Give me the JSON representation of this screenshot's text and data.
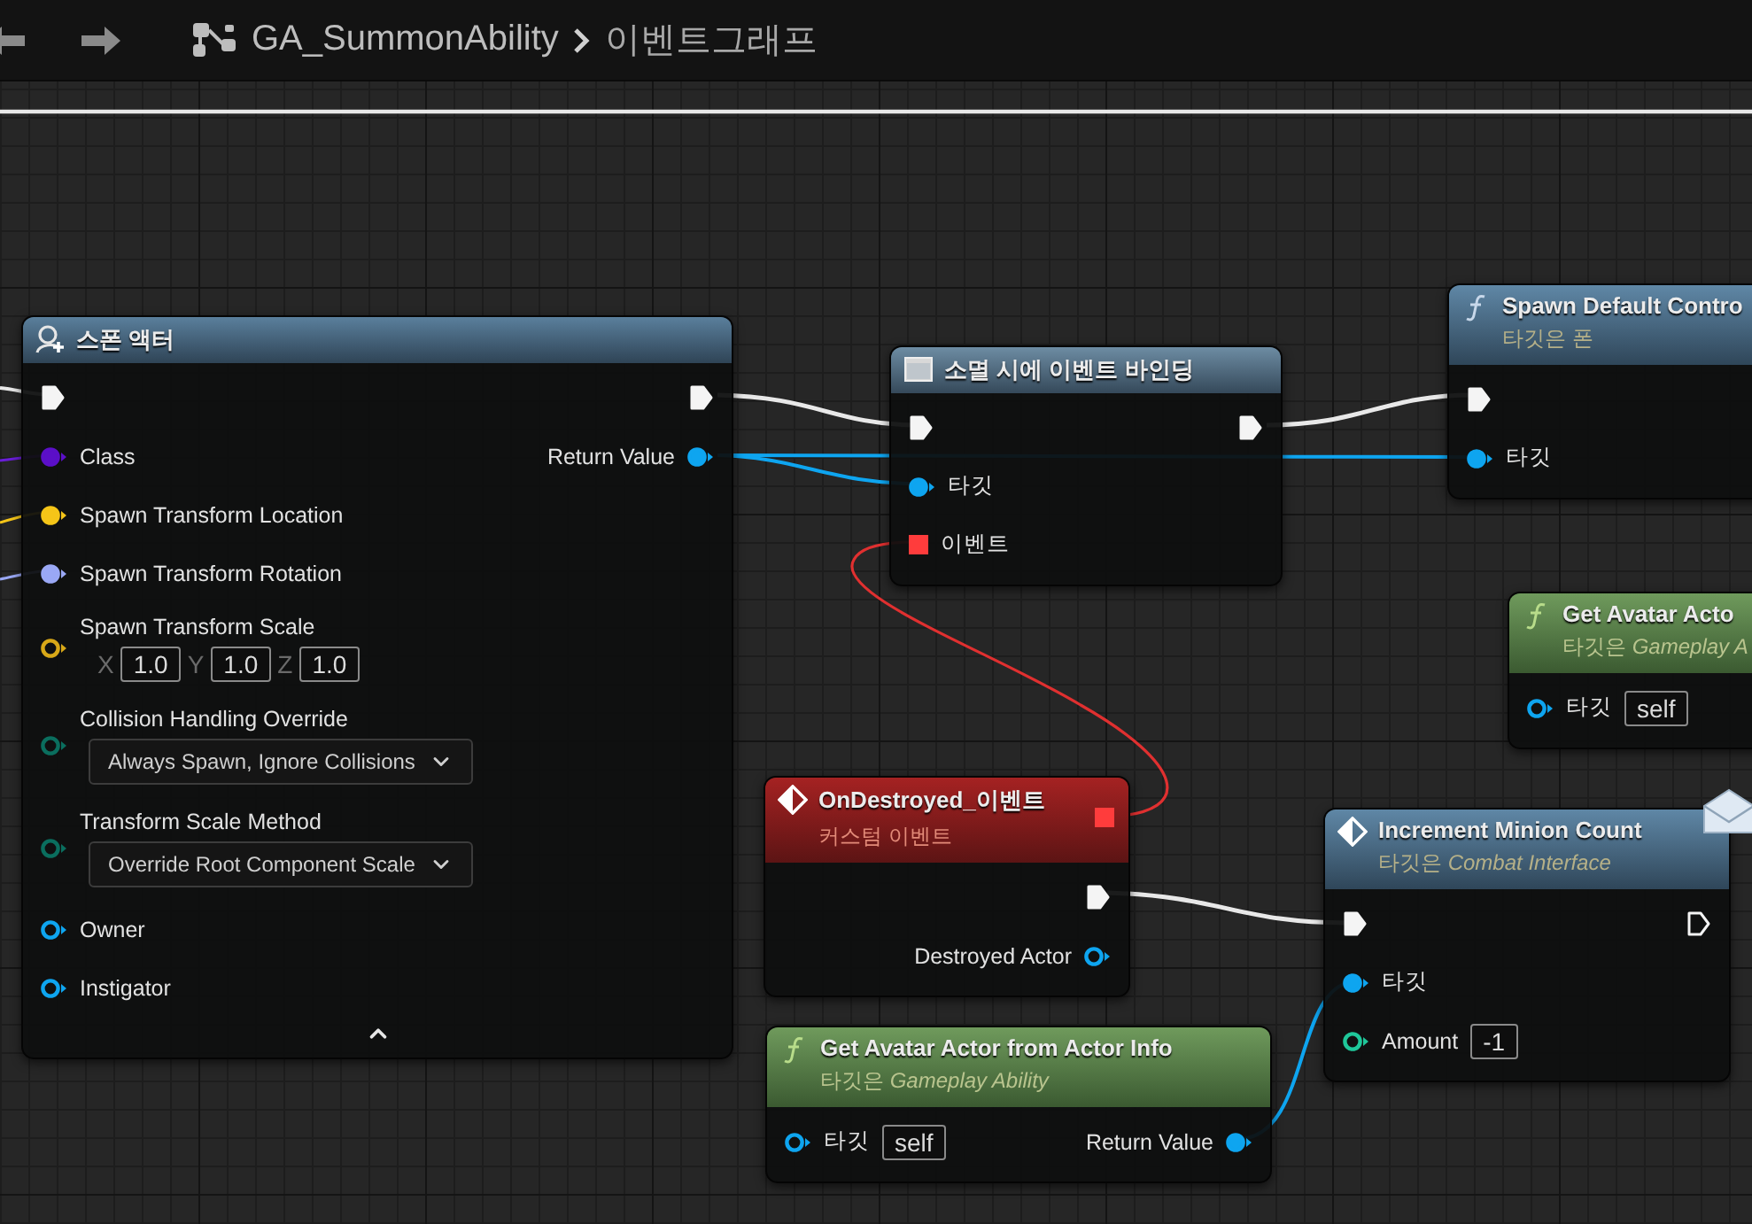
{
  "breadcrumb": {
    "asset": "GA_SummonAbility",
    "graph": "이벤트그래프"
  },
  "nodes": [
    {
      "kind": "spawn",
      "title": "스폰 액터",
      "advanced_expanded": true,
      "rows": [
        {
          "left": {
            "kind": "exec",
            "connected": true
          },
          "right": {
            "kind": "exec",
            "connected": true
          }
        },
        {
          "left": {
            "kind": "data",
            "connected": true,
            "color": "#5b0fc8",
            "label": "Class"
          },
          "right": {
            "kind": "data",
            "connected": true,
            "color": "#0ea5f0",
            "label": "Return Value"
          }
        },
        {
          "left": {
            "kind": "data",
            "connected": true,
            "color": "#f5c518",
            "label": "Spawn Transform Location"
          }
        },
        {
          "left": {
            "kind": "data",
            "connected": true,
            "color": "#9aa8f5",
            "label": "Spawn Transform Rotation"
          }
        },
        {
          "left": {
            "kind": "data",
            "connected": false,
            "color": "#d8a818",
            "label": "Spawn Transform Scale",
            "vector": [
              {
                "axis": "X",
                "value": "1.0"
              },
              {
                "axis": "Y",
                "value": "1.0"
              },
              {
                "axis": "Z",
                "value": "1.0"
              }
            ]
          }
        },
        {
          "left": {
            "kind": "data",
            "connected": false,
            "color": "#0a6e5e",
            "label": "Collision Handling Override",
            "dropdown": "Always Spawn, Ignore Collisions"
          }
        },
        {
          "left": {
            "kind": "data",
            "connected": false,
            "color": "#0a6e5e",
            "label": "Transform Scale Method",
            "dropdown": "Override Root Component Scale"
          }
        },
        {
          "left": {
            "kind": "data",
            "connected": false,
            "color": "#0ea5f0",
            "label": "Owner"
          }
        },
        {
          "left": {
            "kind": "data",
            "connected": false,
            "color": "#0ea5f0",
            "label": "Instigator"
          }
        }
      ]
    },
    {
      "kind": "bind",
      "title": "소멸 시에 이벤트 바인딩",
      "rows": [
        {
          "left": {
            "kind": "exec",
            "connected": true
          },
          "right": {
            "kind": "exec",
            "connected": true
          }
        },
        {
          "left": {
            "kind": "data",
            "connected": true,
            "color": "#0ea5f0",
            "label": "타깃"
          }
        },
        {
          "left": {
            "kind": "delegate",
            "connected": true,
            "color": "#ff3c3c",
            "label": "이벤트"
          }
        }
      ]
    },
    {
      "kind": "call",
      "title": "Spawn Default Contro",
      "subtitle": "타깃은 폰",
      "rows": [
        {
          "left": {
            "kind": "exec",
            "connected": true
          }
        },
        {
          "left": {
            "kind": "data",
            "connected": true,
            "color": "#0ea5f0",
            "label": "타깃"
          }
        }
      ]
    },
    {
      "kind": "pure",
      "title": "Get Avatar Acto",
      "subtitle": "타깃은 *Gameplay A*",
      "rows": [
        {
          "left": {
            "kind": "data",
            "connected": false,
            "color": "#0ea5f0",
            "label": "타깃",
            "value": "self"
          }
        }
      ]
    },
    {
      "kind": "event",
      "title": "OnDestroyed_이벤트",
      "subtitle": "커스텀 이벤트",
      "header_pin": {
        "kind": "delegate",
        "connected": true,
        "color": "#ff3c3c"
      },
      "rows": [
        {
          "right": {
            "kind": "exec",
            "connected": true
          }
        },
        {
          "right": {
            "kind": "data",
            "connected": false,
            "color": "#0ea5f0",
            "label": "Destroyed Actor"
          }
        }
      ]
    },
    {
      "kind": "message",
      "title": "Increment Minion Count",
      "subtitle": "타깃은 *Combat Interface*",
      "rows": [
        {
          "left": {
            "kind": "exec",
            "connected": true
          },
          "right": {
            "kind": "exec",
            "connected": false
          }
        },
        {
          "left": {
            "kind": "data",
            "connected": true,
            "color": "#0ea5f0",
            "label": "타깃"
          }
        },
        {
          "left": {
            "kind": "data",
            "connected": false,
            "color": "#1fc79a",
            "label": "Amount",
            "value": "-1"
          }
        }
      ]
    },
    {
      "kind": "pure",
      "title": "Get Avatar Actor from Actor Info",
      "subtitle": "타깃은 *Gameplay Ability*",
      "rows": [
        {
          "left": {
            "kind": "data",
            "connected": false,
            "color": "#0ea5f0",
            "label": "타깃",
            "value": "self"
          },
          "right": {
            "kind": "data",
            "connected": true,
            "color": "#0ea5f0",
            "label": "Return Value"
          }
        }
      ]
    }
  ]
}
